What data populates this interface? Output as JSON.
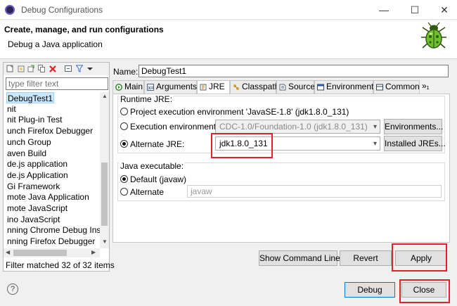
{
  "window": {
    "title": "Debug Configurations",
    "minimize": "—",
    "maximize": "☐",
    "close": "✕"
  },
  "header": {
    "title": "Create, manage, and run configurations",
    "subtitle": "Debug a Java application"
  },
  "left": {
    "toolbar_icons": [
      "new-config-icon",
      "new-prototype-icon",
      "export-icon",
      "duplicate-icon",
      "delete-icon",
      "collapse-all-icon",
      "filter-icon",
      "menu-chevron-icon"
    ],
    "filter_placeholder": "type filter text",
    "tree": [
      "DebugTest1",
      "nit",
      "nit Plug-in Test",
      "unch Firefox Debugger",
      "unch Group",
      "aven Build",
      "de.js application",
      "de.js Application",
      "Gi Framework",
      "mote Java Application",
      "mote JavaScript",
      "ino JavaScript",
      "nning Chrome Debug Insta",
      "nning Firefox Debugger"
    ],
    "selected_index": 0,
    "status": "Filter matched 32 of 32 items"
  },
  "config": {
    "name_label": "Name:",
    "name_value": "DebugTest1",
    "tabs": [
      {
        "label": "Main",
        "icon": "main-tab-icon"
      },
      {
        "label": "Arguments",
        "icon": "arguments-tab-icon"
      },
      {
        "label": "JRE",
        "icon": "jre-tab-icon"
      },
      {
        "label": "Classpath",
        "icon": "classpath-tab-icon"
      },
      {
        "label": "Source",
        "icon": "source-tab-icon"
      },
      {
        "label": "Environment",
        "icon": "environment-tab-icon"
      },
      {
        "label": "Common",
        "icon": "common-tab-icon"
      },
      {
        "label": "»₁",
        "icon": ""
      }
    ],
    "active_tab": "JRE",
    "runtime_jre": {
      "group_label": "Runtime JRE:",
      "project_env_label": "Project execution environment 'JavaSE-1.8' (jdk1.8.0_131)",
      "exec_env_label": "Execution environment:",
      "exec_env_value": "CDC-1.0/Foundation-1.0 (jdk1.8.0_131)",
      "environments_button": "Environments...",
      "alternate_jre_label": "Alternate JRE:",
      "alternate_jre_value": "jdk1.8.0_131",
      "installed_jres_button": "Installed JREs...",
      "selected": "alternate"
    },
    "java_executable": {
      "group_label": "Java executable:",
      "default_label": "Default (javaw)",
      "alternate_label": "Alternate",
      "alternate_value": "javaw",
      "selected": "default"
    },
    "show_command_line": "Show Command Line",
    "revert": "Revert",
    "apply": "Apply"
  },
  "footer": {
    "help": "?",
    "debug": "Debug",
    "close": "Close"
  },
  "colors": {
    "highlight_red": "#e2212e",
    "selection_bg": "#cce8ff",
    "default_button_border": "#0078d7"
  }
}
